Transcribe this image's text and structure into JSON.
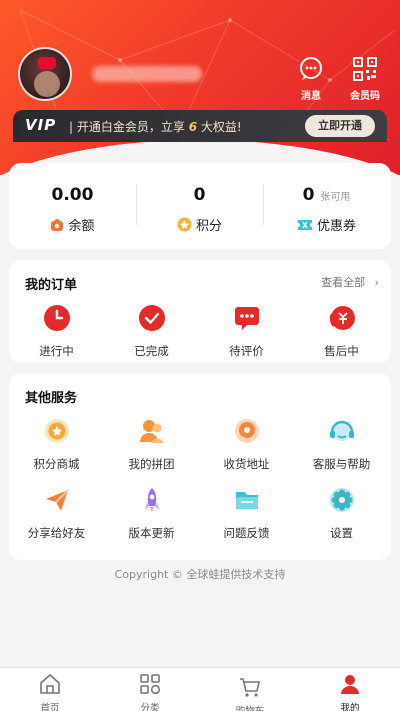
{
  "header": {
    "messages_label": "消息",
    "member_code_label": "会员码"
  },
  "vip": {
    "logo": "VIP",
    "promo_prefix": "| 开通白金会员，立享",
    "promo_number": "6",
    "promo_suffix": "大权益!",
    "button": "立即开通"
  },
  "assets": [
    {
      "value": "0.00",
      "unit": "",
      "label": "余额",
      "icon": "wallet-icon"
    },
    {
      "value": "0",
      "unit": "",
      "label": "积分",
      "icon": "points-icon"
    },
    {
      "value": "0",
      "unit": "张可用",
      "label": "优惠券",
      "icon": "coupon-icon"
    }
  ],
  "orders": {
    "title": "我的订单",
    "view_all": "查看全部",
    "items": [
      {
        "label": "进行中",
        "icon": "clock-icon"
      },
      {
        "label": "已完成",
        "icon": "check-icon"
      },
      {
        "label": "待评价",
        "icon": "comment-icon"
      },
      {
        "label": "售后中",
        "icon": "refund-icon"
      }
    ]
  },
  "services": {
    "title": "其他服务",
    "items": [
      {
        "label": "积分商城",
        "icon": "points-mall-icon"
      },
      {
        "label": "我的拼团",
        "icon": "group-buy-icon"
      },
      {
        "label": "收货地址",
        "icon": "address-icon"
      },
      {
        "label": "客服与帮助",
        "icon": "headset-icon"
      },
      {
        "label": "分享给好友",
        "icon": "share-icon"
      },
      {
        "label": "版本更新",
        "icon": "rocket-icon"
      },
      {
        "label": "问题反馈",
        "icon": "feedback-icon"
      },
      {
        "label": "设置",
        "icon": "settings-icon"
      }
    ]
  },
  "copyright": "Copyright © 全球蛙提供技术支持",
  "tabs": [
    {
      "label": "首页",
      "icon": "home-icon"
    },
    {
      "label": "分类",
      "icon": "category-icon"
    },
    {
      "label": "购物车",
      "icon": "cart-icon"
    },
    {
      "label": "我的",
      "icon": "profile-icon"
    }
  ],
  "colors": {
    "accent": "#e8242a",
    "vip_bg": "#2b2b2f",
    "gold": "#f7c35b"
  }
}
